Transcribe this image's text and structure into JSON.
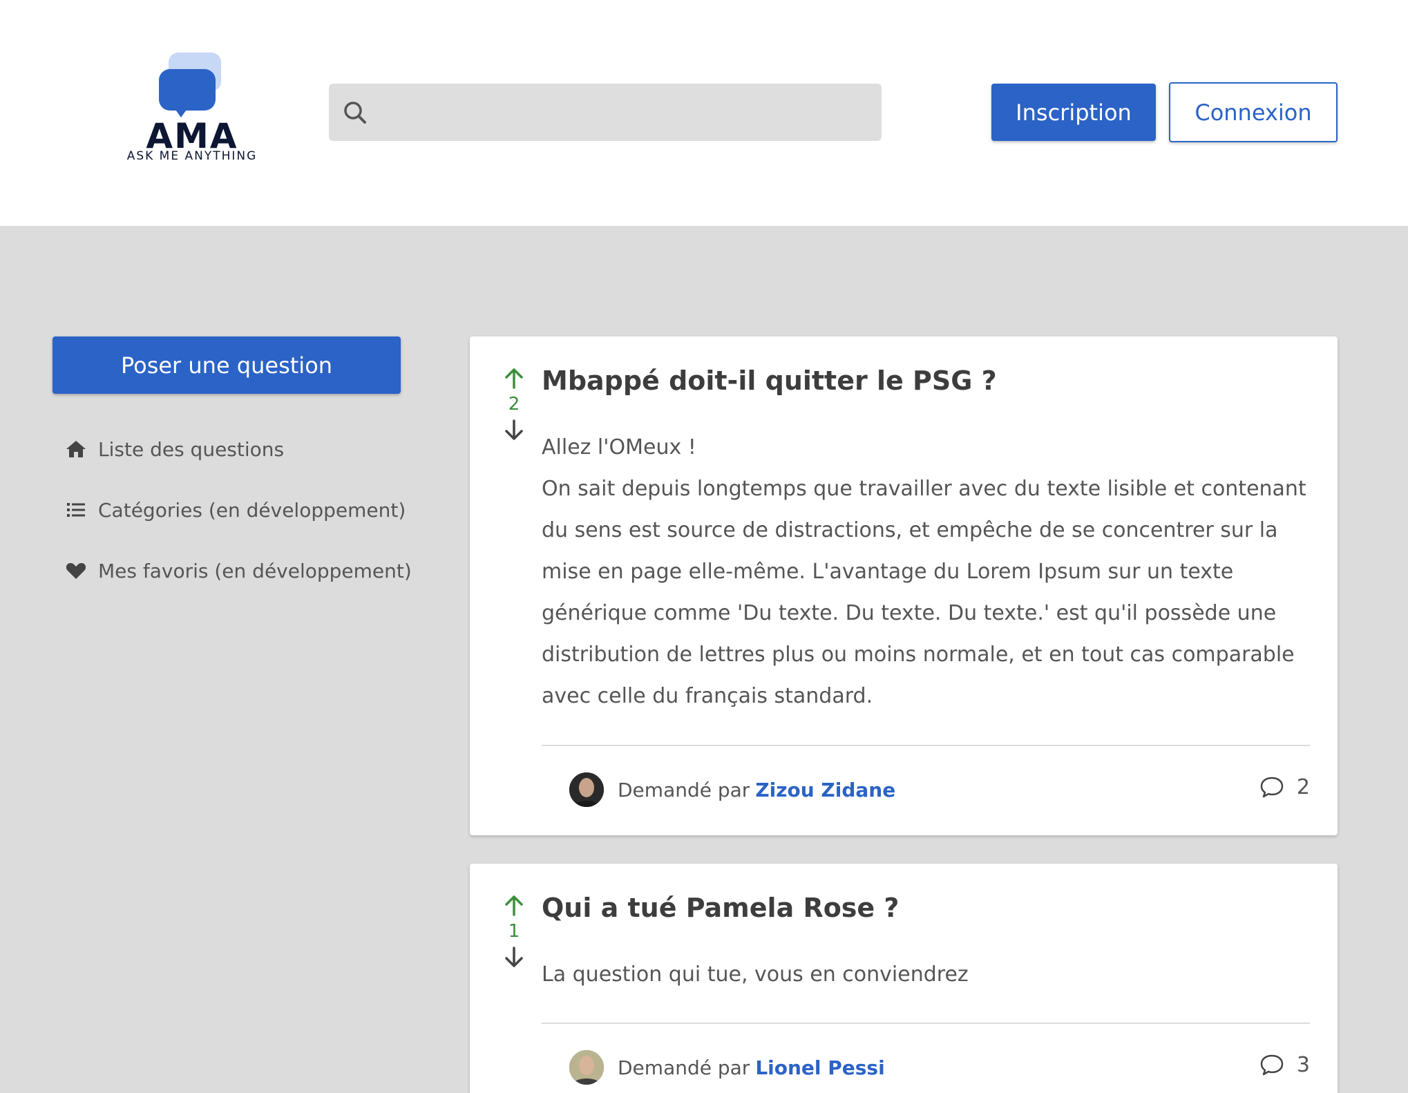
{
  "header": {
    "logo_text": "AMA",
    "logo_subtitle": "ASK ME ANYTHING",
    "search_placeholder": "",
    "signup_label": "Inscription",
    "login_label": "Connexion"
  },
  "sidebar": {
    "ask_label": "Poser une question",
    "items": [
      {
        "label": "Liste des questions",
        "icon": "home-icon"
      },
      {
        "label": "Catégories (en développement)",
        "icon": "list-icon"
      },
      {
        "label": "Mes favoris (en développement)",
        "icon": "heart-icon"
      }
    ]
  },
  "questions": [
    {
      "votes": "2",
      "title": "Mbappé doit-il quitter le PSG ?",
      "body_lines": [
        "Allez l'OMeux !",
        "On sait depuis longtemps que travailler avec du texte lisible et contenant",
        "du sens est source de distractions, et empêche de se concentrer sur la",
        "mise en page elle-même. L'avantage du Lorem Ipsum sur un texte",
        "générique comme 'Du texte. Du texte. Du texte.' est qu'il possède une",
        "distribution de lettres plus ou moins normale, et en tout cas comparable",
        "avec celle du français standard."
      ],
      "asked_by_label": "Demandé par",
      "author": "Zizou Zidane",
      "comments": "2"
    },
    {
      "votes": "1",
      "title": "Qui a tué Pamela Rose ?",
      "body_lines": [
        "La question qui tue, vous en conviendrez"
      ],
      "asked_by_label": "Demandé par",
      "author": "Lionel Pessi",
      "comments": "3"
    }
  ],
  "colors": {
    "accent": "#2b63c6",
    "vote_up": "#3a8f3a",
    "background": "#dcdcdc"
  }
}
